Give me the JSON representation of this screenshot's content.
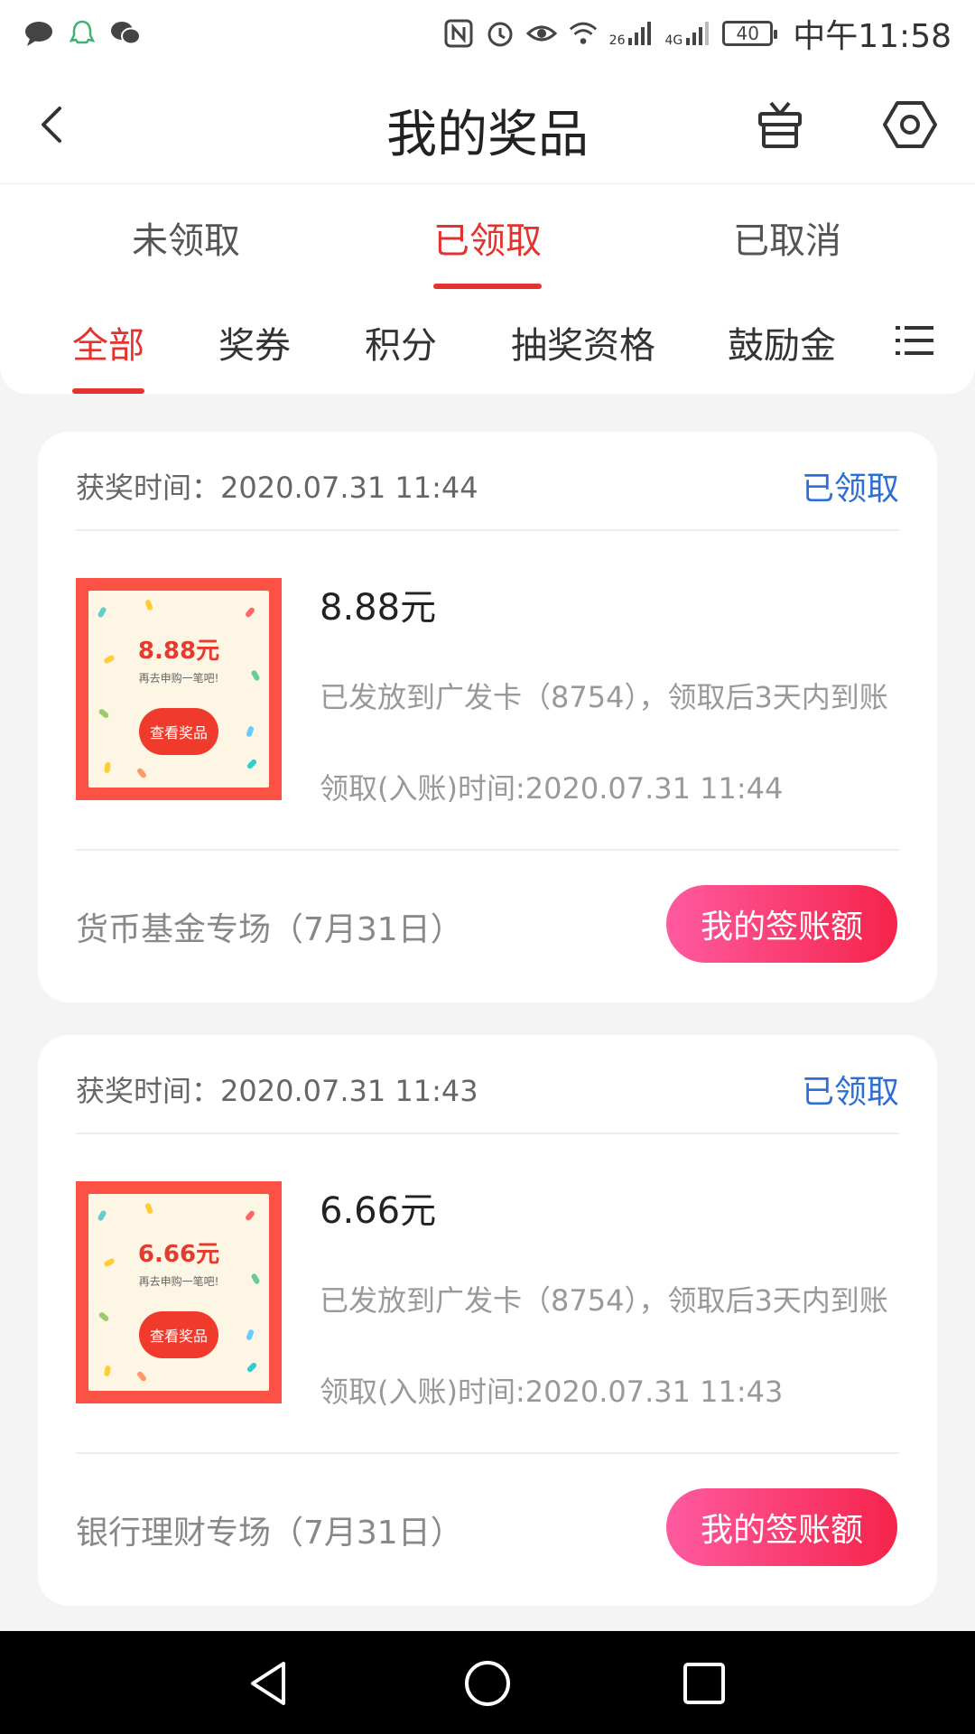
{
  "status_bar": {
    "battery": "40",
    "time": "中午11:58",
    "net1": "26",
    "net2": "4G"
  },
  "header": {
    "title": "我的奖品"
  },
  "status_tabs": [
    {
      "label": "未领取",
      "active": false
    },
    {
      "label": "已领取",
      "active": true
    },
    {
      "label": "已取消",
      "active": false
    }
  ],
  "category_tabs": [
    {
      "label": "全部",
      "active": true
    },
    {
      "label": "奖券",
      "active": false
    },
    {
      "label": "积分",
      "active": false
    },
    {
      "label": "抽奖资格",
      "active": false
    },
    {
      "label": "鼓励金",
      "active": false
    }
  ],
  "prizes": [
    {
      "win_time": "获奖时间：2020.07.31 11:44",
      "status": "已领取",
      "thumb_amount": "8.88元",
      "thumb_sub": "再去申购一笔吧!",
      "thumb_button": "查看奖品",
      "name": "8.88元",
      "description": "已发放到广发卡（8754），领取后3天内到账",
      "claim_time": "领取(入账)时间:2020.07.31 11:44",
      "event": "货币基金专场（7月31日）",
      "button": "我的签账额"
    },
    {
      "win_time": "获奖时间：2020.07.31 11:43",
      "status": "已领取",
      "thumb_amount": "6.66元",
      "thumb_sub": "再去申购一笔吧!",
      "thumb_button": "查看奖品",
      "name": "6.66元",
      "description": "已发放到广发卡（8754），领取后3天内到账",
      "claim_time": "领取(入账)时间:2020.07.31 11:43",
      "event": "银行理财专场（7月31日）",
      "button": "我的签账额"
    }
  ],
  "colors": {
    "accent": "#e4332e",
    "link": "#2d6fd6",
    "button_gradient_start": "#ff5aa0",
    "button_gradient_end": "#f5244a",
    "thumb_border": "#fb5245"
  }
}
